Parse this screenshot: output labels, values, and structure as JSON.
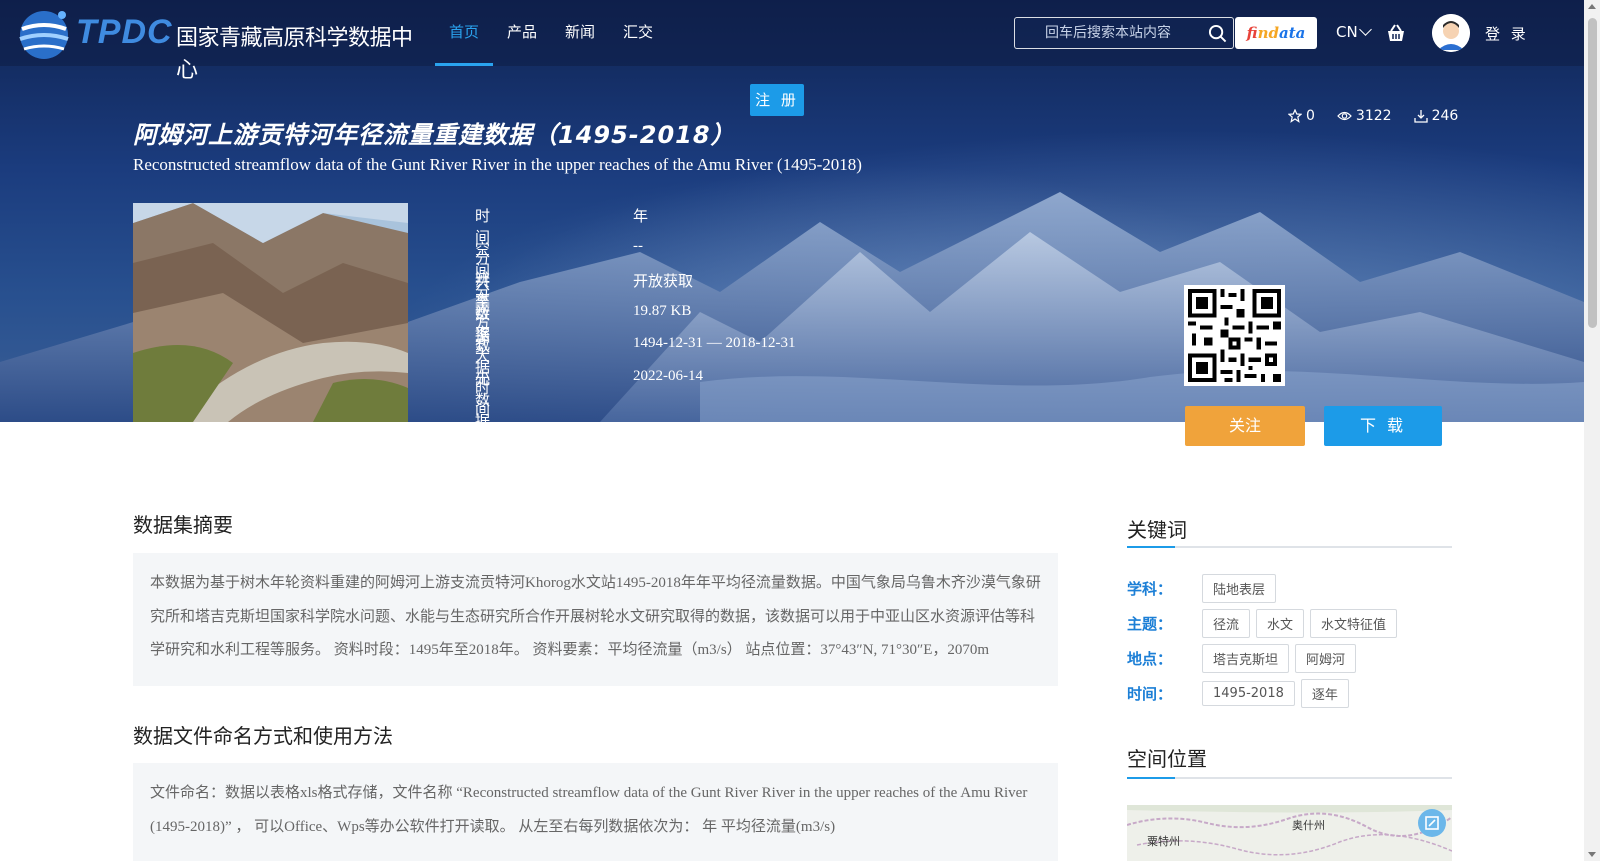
{
  "header": {
    "logo_abbr": "TPDC",
    "logo_name": "国家青藏高原科学数据中心",
    "nav": [
      {
        "label": "首页",
        "active": true
      },
      {
        "label": "产品",
        "active": false
      },
      {
        "label": "新闻",
        "active": false
      },
      {
        "label": "汇交",
        "active": false
      }
    ],
    "search_placeholder": "回车后搜索本站内容",
    "findata": {
      "p1": "fi",
      "p2": "nd",
      "p3": "ata"
    },
    "lang": "CN",
    "login": "登 录",
    "register": "注 册"
  },
  "dataset": {
    "title_cn": "阿姆河上游贡特河年径流量重建数据（1495-2018）",
    "title_en": "Reconstructed streamflow data of the Gunt River River in the upper reaches of the Amu River (1495-2018)",
    "stats": {
      "stars": "0",
      "views": "3122",
      "downloads": "246"
    },
    "meta": [
      {
        "label": "时间分辨率",
        "value": "年"
      },
      {
        "label": "空间分辨率",
        "value": "--"
      },
      {
        "label": "共享方式",
        "value": "开放获取"
      },
      {
        "label": "数据大小",
        "value": "19.87 KB"
      },
      {
        "label": "数据时间范围",
        "value": "1494-12-31 — 2018-12-31"
      },
      {
        "label": "元数据更新时间",
        "value": "2022-06-14"
      }
    ],
    "follow_label": "关注",
    "download_label": "下 载"
  },
  "abstract": {
    "title": "数据集摘要",
    "text": "本数据为基于树木年轮资料重建的阿姆河上游支流贡特河Khorog水文站1495-2018年年平均径流量数据。中国气象局乌鲁木齐沙漠气象研究所和塔吉克斯坦国家科学院水问题、水能与生态研究所合作开展树轮水文研究取得的数据，该数据可以用于中亚山区水资源评估等科学研究和水利工程等服务。 资料时段：1495年至2018年。 资料要素：平均径流量（m3/s） 站点位置：37°43″N, 71°30″E，2070m"
  },
  "naming": {
    "title": "数据文件命名方式和使用方法",
    "text": "文件命名：数据以表格xls格式存储，文件名称 “Reconstructed streamflow data of the Gunt River River in the upper reaches of the Amu River (1495-2018)” ， 可以Office、Wps等办公软件打开读取。 从左至右每列数据依次为： 年 平均径流量(m3/s)"
  },
  "keywords": {
    "title": "关键词",
    "rows": [
      {
        "label": "学科：",
        "tags": [
          "陆地表层"
        ]
      },
      {
        "label": "主题：",
        "tags": [
          "径流",
          "水文",
          "水文特征值"
        ]
      },
      {
        "label": "地点：",
        "tags": [
          "塔吉克斯坦",
          "阿姆河"
        ]
      },
      {
        "label": "时间：",
        "tags": [
          "1495-2018",
          "逐年"
        ]
      }
    ]
  },
  "location": {
    "title": "空间位置",
    "map_labels": {
      "city1": "奥什州",
      "city2": "粟特州"
    }
  },
  "colors": {
    "accent": "#1c9be8",
    "follow": "#f0a33b",
    "keyword_label": "#1c7fd6"
  }
}
